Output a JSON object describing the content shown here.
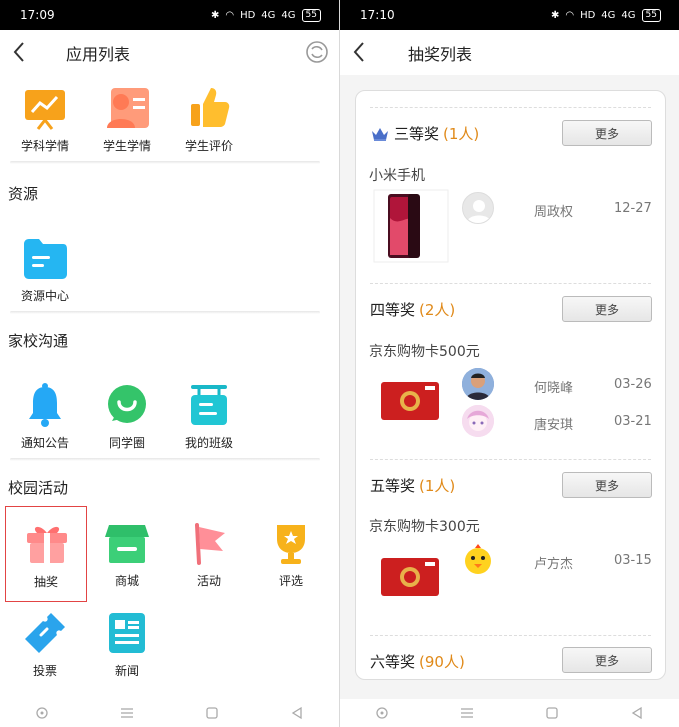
{
  "left": {
    "status": {
      "time": "17:09",
      "hd": "HD",
      "sig": "4G",
      "battery": "55"
    },
    "title": "应用列表",
    "row1": [
      "学科学情",
      "学生学情",
      "学生评价"
    ],
    "sections": {
      "resources": {
        "title": "资源",
        "items": [
          "资源中心"
        ]
      },
      "home_school": {
        "title": "家校沟通",
        "items": [
          "通知公告",
          "同学圈",
          "我的班级"
        ]
      },
      "campus": {
        "title": "校园活动",
        "items": [
          "抽奖",
          "商城",
          "活动",
          "评选",
          "投票",
          "新闻"
        ]
      }
    }
  },
  "right": {
    "status": {
      "time": "17:10",
      "hd": "HD",
      "sig": "4G",
      "battery": "55"
    },
    "title": "抽奖列表",
    "more_label": "更多",
    "tiers": [
      {
        "name": "三等奖",
        "count": "(1人)",
        "prize": "小米手机",
        "winners": [
          {
            "name": "周政权",
            "date": "12-27"
          }
        ]
      },
      {
        "name": "四等奖",
        "count": "(2人)",
        "prize": "京东购物卡500元",
        "winners": [
          {
            "name": "何晓峰",
            "date": "03-26"
          },
          {
            "name": "唐安琪",
            "date": "03-21"
          }
        ]
      },
      {
        "name": "五等奖",
        "count": "(1人)",
        "prize": "京东购物卡300元",
        "winners": [
          {
            "name": "卢方杰",
            "date": "03-15"
          }
        ]
      },
      {
        "name": "六等奖",
        "count": "(90人)"
      }
    ]
  },
  "colors": {
    "accent": "#e08a1a",
    "selected_border": "#e24444"
  }
}
